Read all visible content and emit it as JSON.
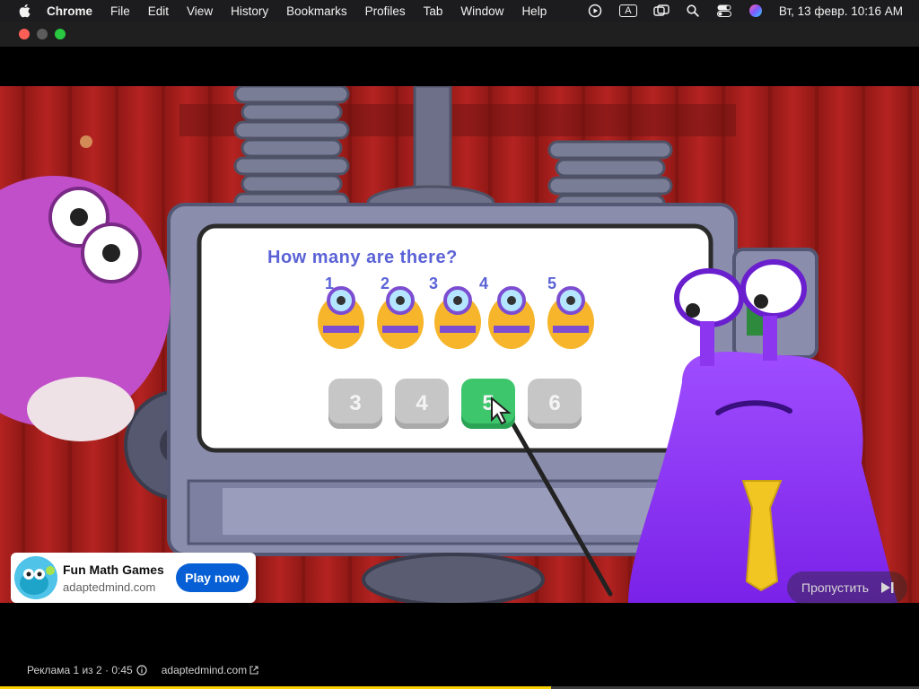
{
  "menubar": {
    "app": "Chrome",
    "items": [
      "File",
      "Edit",
      "View",
      "History",
      "Bookmarks",
      "Profiles",
      "Tab",
      "Window",
      "Help"
    ],
    "status_icons": [
      "play-circle-icon",
      "keyboard-input-icon",
      "screen-mirror-icon",
      "search-icon",
      "control-center-icon",
      "siri-icon"
    ],
    "input_letter": "A",
    "datetime": "Вт, 13 февр.  10:16 AM"
  },
  "video": {
    "question": "How many are there?",
    "count_labels": [
      "1",
      "2",
      "3",
      "4",
      "5"
    ],
    "answers": [
      {
        "label": "3",
        "state": "default"
      },
      {
        "label": "4",
        "state": "default"
      },
      {
        "label": "5",
        "state": "selected"
      },
      {
        "label": "6",
        "state": "default"
      }
    ]
  },
  "ad": {
    "title": "Fun Math Games",
    "domain": "adaptedmind.com",
    "cta": "Play now",
    "skip_label": "Пропустить",
    "footer_text": "Реклама 1 из 2 · 0:45",
    "footer_link": "adaptedmind.com",
    "progress": 0.6
  },
  "colors": {
    "accent_blue": "#065fd4",
    "correct_green": "#3ec66d",
    "progress_yellow": "#f9d000"
  }
}
